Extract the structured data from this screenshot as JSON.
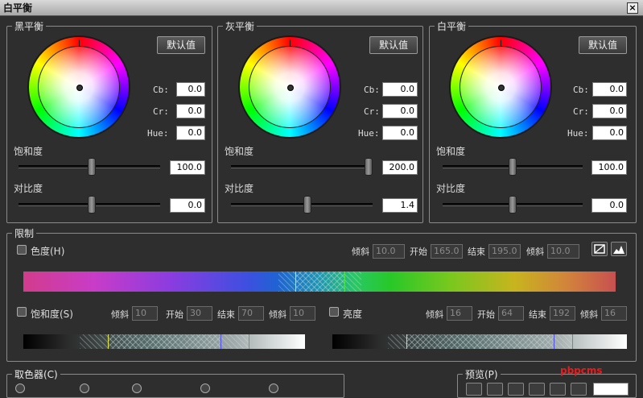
{
  "window": {
    "title": "白平衡",
    "close_glyph": "×"
  },
  "black_balance": {
    "legend": "黑平衡",
    "default_button": "默认值",
    "cb_label": "Cb:",
    "cb_value": "0.0",
    "cr_label": "Cr:",
    "cr_value": "0.0",
    "hue_label": "Hue:",
    "hue_value": "0.0",
    "saturation_label": "饱和度",
    "saturation_value": "100.0",
    "contrast_label": "对比度",
    "contrast_value": "0.0"
  },
  "gray_balance": {
    "legend": "灰平衡",
    "default_button": "默认值",
    "cb_label": "Cb:",
    "cb_value": "0.0",
    "cr_label": "Cr:",
    "cr_value": "0.0",
    "hue_label": "Hue:",
    "hue_value": "0.0",
    "saturation_label": "饱和度",
    "saturation_value": "200.0",
    "contrast_label": "对比度",
    "contrast_value": "1.4"
  },
  "white_balance": {
    "legend": "白平衡",
    "default_button": "默认值",
    "cb_label": "Cb:",
    "cb_value": "0.0",
    "cr_label": "Cr:",
    "cr_value": "0.0",
    "hue_label": "Hue:",
    "hue_value": "0.0",
    "saturation_label": "饱和度",
    "saturation_value": "100.0",
    "contrast_label": "对比度",
    "contrast_value": "0.0"
  },
  "limit": {
    "legend": "限制",
    "hue": {
      "label": "色度(H)",
      "slope1_label": "倾斜",
      "slope1_value": "10.0",
      "start_label": "开始",
      "start_value": "165.0",
      "end_label": "结束",
      "end_value": "195.0",
      "slope2_label": "倾斜",
      "slope2_value": "10.0"
    },
    "saturation": {
      "label": "饱和度(S)",
      "slope1_label": "倾斜",
      "slope1_value": "10",
      "start_label": "开始",
      "start_value": "30",
      "end_label": "结束",
      "end_value": "70",
      "slope2_label": "倾斜",
      "slope2_value": "10"
    },
    "brightness": {
      "label": "亮度",
      "slope1_label": "倾斜",
      "slope1_value": "16",
      "start_label": "开始",
      "start_value": "64",
      "end_label": "结束",
      "end_value": "192",
      "slope2_label": "倾斜",
      "slope2_value": "16"
    }
  },
  "picker": {
    "legend": "取色器(C)"
  },
  "preview": {
    "legend": "预览(P)"
  },
  "watermark": "pbpcms"
}
